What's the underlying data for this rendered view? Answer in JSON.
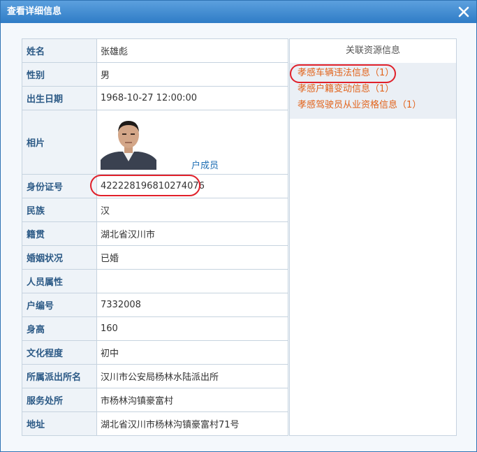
{
  "window": {
    "title": "查看详细信息"
  },
  "person": {
    "rows": [
      {
        "label": "姓名",
        "value": "张雄彪"
      },
      {
        "label": "性别",
        "value": "男"
      },
      {
        "label": "出生日期",
        "value": "1968-10-27 12:00:00"
      },
      {
        "label": "相片",
        "value": "户成员"
      },
      {
        "label": "身份证号",
        "value": "422228196810274076"
      },
      {
        "label": "民族",
        "value": "汉"
      },
      {
        "label": "籍贯",
        "value": "湖北省汉川市"
      },
      {
        "label": "婚姻状况",
        "value": "已婚"
      },
      {
        "label": "人员属性",
        "value": ""
      },
      {
        "label": "户编号",
        "value": "7332008"
      },
      {
        "label": "身高",
        "value": "160"
      },
      {
        "label": "文化程度",
        "value": "初中"
      },
      {
        "label": "所属派出所名",
        "value": "汉川市公安局杨林水陆派出所"
      },
      {
        "label": "服务处所",
        "value": "市杨林沟镇豪富村"
      },
      {
        "label": "地址",
        "value": "湖北省汉川市杨林沟镇豪富村71号"
      }
    ]
  },
  "related": {
    "title": "关联资源信息",
    "items": [
      {
        "label": "孝感车辆违法信息（1）"
      },
      {
        "label": "孝感户籍变动信息（1）"
      },
      {
        "label": "孝感驾驶员从业资格信息（1）"
      }
    ]
  },
  "colors": {
    "title_bar": "#3a86cf",
    "label_text": "#2c5a86",
    "name_text": "#c6281c",
    "link_text": "#1f6fb4",
    "related_link": "#e2631b",
    "highlight_oval": "#e0202a"
  },
  "icons": {
    "close": "close-icon",
    "photo": "person-photo"
  }
}
